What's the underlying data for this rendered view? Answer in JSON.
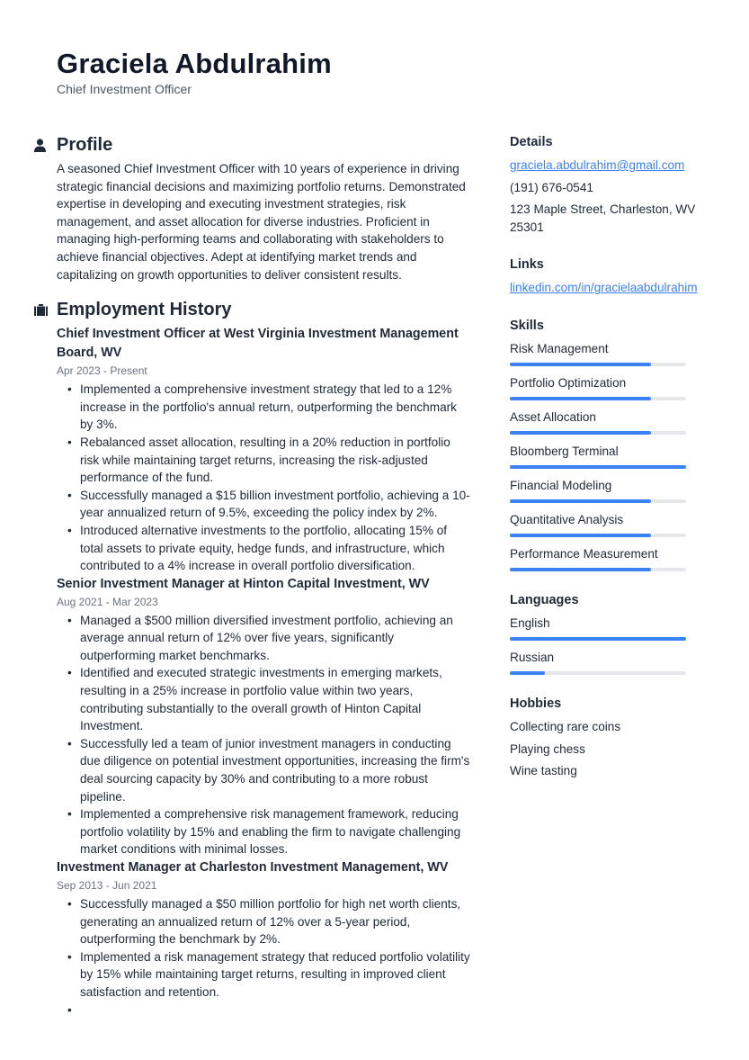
{
  "header": {
    "name": "Graciela Abdulrahim",
    "title": "Chief Investment Officer"
  },
  "profile": {
    "heading": "Profile",
    "icon": "person-icon",
    "text": "A seasoned Chief Investment Officer with 10 years of experience in driving strategic financial decisions and maximizing portfolio returns. Demonstrated expertise in developing and executing investment strategies, risk management, and asset allocation for diverse industries. Proficient in managing high-performing teams and collaborating with stakeholders to achieve financial objectives. Adept at identifying market trends and capitalizing on growth opportunities to deliver consistent results."
  },
  "employment": {
    "heading": "Employment History",
    "icon": "briefcase-icon",
    "jobs": [
      {
        "title": "Chief Investment Officer at West Virginia Investment Management Board, WV",
        "dates": "Apr 2023 - Present",
        "bullets": [
          "Implemented a comprehensive investment strategy that led to a 12% increase in the portfolio's annual return, outperforming the benchmark by 3%.",
          "Rebalanced asset allocation, resulting in a 20% reduction in portfolio risk while maintaining target returns, increasing the risk-adjusted performance of the fund.",
          "Successfully managed a $15 billion investment portfolio, achieving a 10-year annualized return of 9.5%, exceeding the policy index by 2%.",
          "Introduced alternative investments to the portfolio, allocating 15% of total assets to private equity, hedge funds, and infrastructure, which contributed to a 4% increase in overall portfolio diversification."
        ]
      },
      {
        "title": "Senior Investment Manager at Hinton Capital Investment, WV",
        "dates": "Aug 2021 - Mar 2023",
        "bullets": [
          "Managed a $500 million diversified investment portfolio, achieving an average annual return of 12% over five years, significantly outperforming market benchmarks.",
          "Identified and executed strategic investments in emerging markets, resulting in a 25% increase in portfolio value within two years, contributing substantially to the overall growth of Hinton Capital Investment.",
          "Successfully led a team of junior investment managers in conducting due diligence on potential investment opportunities, increasing the firm's deal sourcing capacity by 30% and contributing to a more robust pipeline.",
          "Implemented a comprehensive risk management framework, reducing portfolio volatility by 15% and enabling the firm to navigate challenging market conditions with minimal losses."
        ]
      },
      {
        "title": "Investment Manager at Charleston Investment Management, WV",
        "dates": "Sep 2013 - Jun 2021",
        "bullets": [
          "Successfully managed a $50 million portfolio for high net worth clients, generating an annualized return of 12% over a 5-year period, outperforming the benchmark by 2%.",
          "Implemented a risk management strategy that reduced portfolio volatility by 15% while maintaining target returns, resulting in improved client satisfaction and retention.",
          ""
        ]
      }
    ]
  },
  "details": {
    "heading": "Details",
    "email": "graciela.abdulrahim@gmail.com",
    "phone": "(191) 676-0541",
    "address": "123 Maple Street, Charleston, WV 25301"
  },
  "links": {
    "heading": "Links",
    "items": [
      "linkedin.com/in/gracielaabdulrahim"
    ]
  },
  "skills": {
    "heading": "Skills",
    "items": [
      {
        "label": "Risk Management",
        "level": 0.8
      },
      {
        "label": "Portfolio Optimization",
        "level": 0.8
      },
      {
        "label": "Asset Allocation",
        "level": 0.8
      },
      {
        "label": "Bloomberg Terminal",
        "level": 1.0
      },
      {
        "label": "Financial Modeling",
        "level": 0.8
      },
      {
        "label": "Quantitative Analysis",
        "level": 0.8
      },
      {
        "label": "Performance Measurement",
        "level": 0.8
      }
    ]
  },
  "languages": {
    "heading": "Languages",
    "items": [
      {
        "label": "English",
        "level": 1.0
      },
      {
        "label": "Russian",
        "level": 0.2
      }
    ]
  },
  "hobbies": {
    "heading": "Hobbies",
    "items": [
      "Collecting rare coins",
      "Playing chess",
      "Wine tasting"
    ]
  },
  "colors": {
    "accent": "#3b82f6",
    "track": "#e5e7eb",
    "text": "#1f2937",
    "muted": "#6b7280"
  }
}
